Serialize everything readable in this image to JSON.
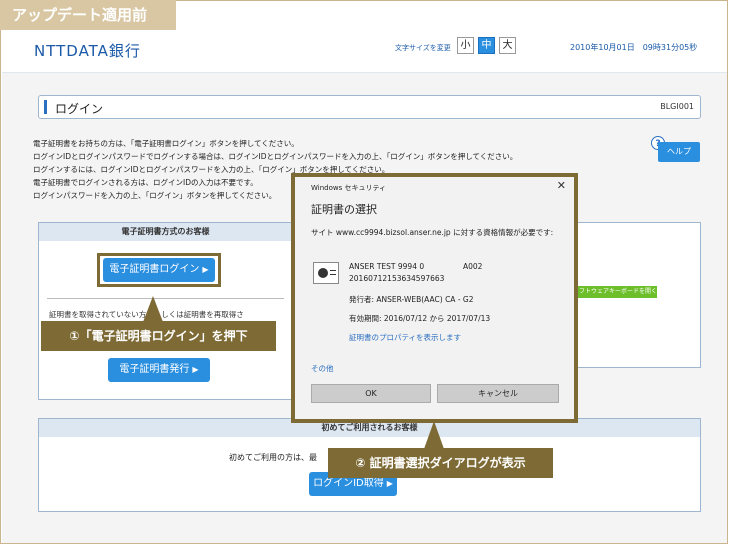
{
  "label_tag": "アップデート適用前",
  "header": {
    "logo": "NTTDATA銀行",
    "font_size_label": "文字サイズを変更",
    "font_sizes": [
      "小",
      "中",
      "大"
    ],
    "active_font_size": "中",
    "datetime": "2010年10月01日　09時31分05秒"
  },
  "page": {
    "title": "ログイン",
    "id": "BLGI001",
    "instructions": [
      "電子証明書をお持ちの方は、「電子証明書ログイン」ボタンを押してください。",
      "ログインIDとログインパスワードでログインする場合は、ログインIDとログインパスワードを入力の上、「ログイン」ボタンを押してください。",
      "ログインするには、ログインIDとログインパスワードを入力の上、「ログイン」ボタンを押してください。",
      "電子証明書でログインされる方は、ログインIDの入力は不要です。",
      "ログインパスワードを入力の上、「ログイン」ボタンを押してください。"
    ],
    "help_label": "ヘルプ"
  },
  "cert_panel": {
    "heading": "電子証明書方式のお客様",
    "login_button": "電子証明書ログイン",
    "note": "証明書を取得されていない方、もしくは証明書を再取得さ",
    "issue_button": "電子証明書発行"
  },
  "first_panel": {
    "heading": "初めてご利用されるお客様",
    "text": "初めてご利用の方は、最",
    "button": "ログインID取得"
  },
  "software_keyboard": "ソフトウェアキーボードを開く",
  "callouts": {
    "step1": "①「電子証明書ログイン」を押下",
    "step2": "② 証明書選択ダイアログが表示"
  },
  "dialog": {
    "window_title": "Windows セキュリティ",
    "heading": "証明書の選択",
    "site_text": "サイト www.cc9994.bizsol.anser.ne.jp に対する資格情報が必要です:",
    "cert_name": "ANSER TEST 9994 0",
    "cert_code": "A002",
    "cert_serial": "20160712153634597663",
    "issuer": "発行者: ANSER-WEB(AAC) CA - G2",
    "validity": "有効期間: 2016/07/12 から 2017/07/13",
    "properties_link": "証明書のプロパティを表示します",
    "other_link": "その他",
    "ok": "OK",
    "cancel": "キャンセル"
  }
}
